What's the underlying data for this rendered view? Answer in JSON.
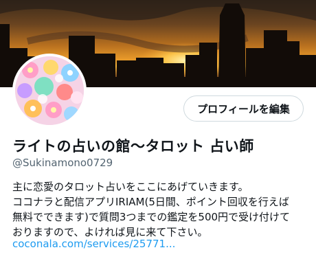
{
  "profile": {
    "display_name": "ライトの占いの館〜タロット 占い師",
    "handle": "@Sukinamono0729",
    "bio_lines": [
      "主に恋愛のタロット占いをここにあげていきます。",
      "ココナラと配信アプリIRIAM(5日間、ポイント回収を行えば",
      "無料でできます)で質問3つまでの鑑定を500円で受け付けて",
      "おりますので、よければ見に来て下さい。"
    ],
    "link_text": "coconala.com/services/25771..."
  },
  "actions": {
    "edit_profile_label": "プロフィールを編集"
  },
  "colors": {
    "link": "#1d9bf0",
    "secondary_text": "#536471",
    "button_border": "#cfd9de"
  }
}
